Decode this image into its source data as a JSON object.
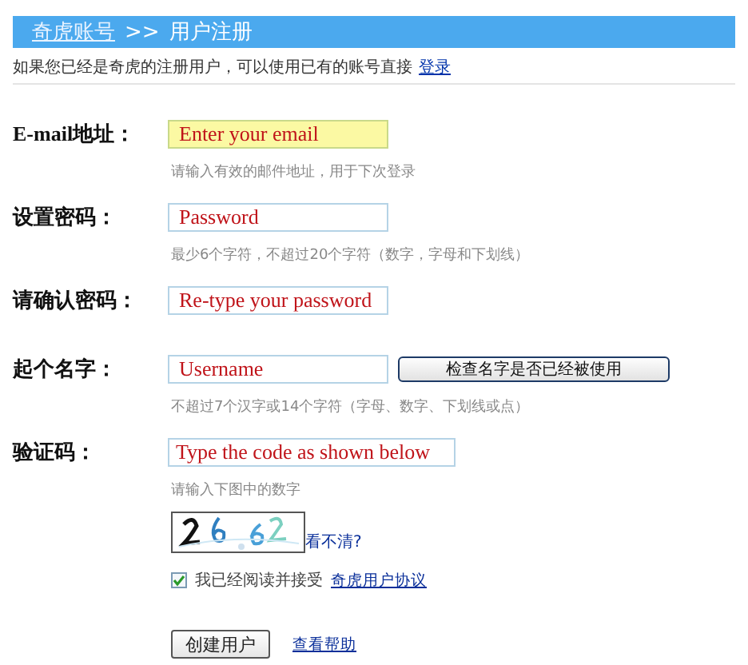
{
  "header": {
    "link": "奇虎账号",
    "separator": ">>",
    "title": "用户注册"
  },
  "intro": {
    "text": "如果您已经是奇虎的注册用户，可以使用已有的账号直接",
    "link": "登录"
  },
  "fields": [
    {
      "label": "E-mail地址：",
      "placeholder": "Enter your email",
      "focused": true,
      "hint": "请输入有效的邮件地址，用于下次登录"
    },
    {
      "label": "设置密码：",
      "placeholder": "Password",
      "focused": false,
      "hint": "最少6个字符，不超过20个字符（数字，字母和下划线）"
    },
    {
      "label": "请确认密码：",
      "placeholder": "Re-type your password",
      "focused": false
    },
    {
      "label": "起个名字：",
      "placeholder": "Username",
      "focused": false,
      "button": "检查名字是否已经被使用",
      "hint": "不超过7个汉字或14个字符（字母、数字、下划线或点）"
    },
    {
      "label": "验证码：",
      "placeholder": "Type the code as shown below",
      "focused": false,
      "hint": "请输入下图中的数字"
    }
  ],
  "captcha": {
    "kind": "picture",
    "refresh_link": "看不清?"
  },
  "agreement": {
    "checked": true,
    "text": "我已经阅读并接受",
    "link": "奇虎用户协议"
  },
  "submit_button": "创建用户",
  "help_link": "查看帮助"
}
